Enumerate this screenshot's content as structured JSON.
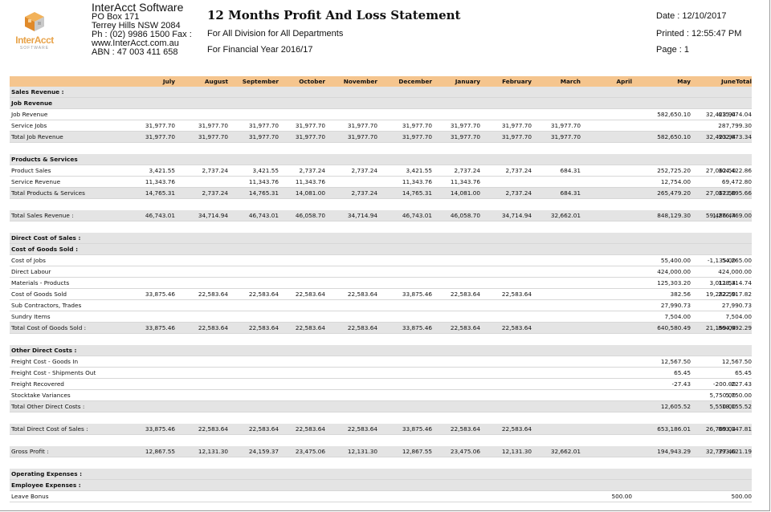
{
  "company": {
    "logo_text": "InterAcct",
    "logo_sub": "SOFTWARE",
    "name": "InterAcct Software",
    "address1": "PO Box 171",
    "address2": "Terrey Hills NSW 2084",
    "phone": "Ph : (02) 9986 1500 Fax :",
    "web": "www.InterAcct.com.au",
    "abn": "ABN : 47 003 411 658"
  },
  "report": {
    "title": "12 Months Profit And Loss Statement",
    "subtitle1": "For All Division for All Departments",
    "subtitle2": "For Financial Year 2016/17",
    "date": "Date : 12/10/2017",
    "printed": "Printed : 12:55:47 PM",
    "page": "Page : 1"
  },
  "columns": [
    "July",
    "August",
    "September",
    "October",
    "November",
    "December",
    "January",
    "February",
    "March",
    "April",
    "May",
    "June",
    "Total"
  ],
  "rows": [
    {
      "label": "Sales Revenue :",
      "style": "heading",
      "shade": true,
      "values": []
    },
    {
      "label": "Job Revenue",
      "style": "heading",
      "shade": true,
      "values": []
    },
    {
      "label": "Job Revenue",
      "style": "line",
      "values": [
        "",
        "",
        "",
        "",
        "",
        "",
        "",
        "",
        "",
        "",
        "582,650.10",
        "32,423.94",
        "615,074.04"
      ]
    },
    {
      "label": "Service Jobs",
      "style": "line",
      "values": [
        "31,977.70",
        "31,977.70",
        "31,977.70",
        "31,977.70",
        "31,977.70",
        "31,977.70",
        "31,977.70",
        "31,977.70",
        "31,977.70",
        "",
        "",
        "",
        "287,799.30"
      ]
    },
    {
      "label": "Total Job Revenue",
      "style": "total",
      "shade": true,
      "values": [
        "31,977.70",
        "31,977.70",
        "31,977.70",
        "31,977.70",
        "31,977.70",
        "31,977.70",
        "31,977.70",
        "31,977.70",
        "31,977.70",
        "",
        "582,650.10",
        "32,423.94",
        "902,873.34"
      ]
    },
    {
      "label": "",
      "style": "blank",
      "values": []
    },
    {
      "label": "Products & Services",
      "style": "heading",
      "shade": true,
      "values": []
    },
    {
      "label": "Product Sales",
      "style": "line",
      "values": [
        "3,421.55",
        "2,737.24",
        "3,421.55",
        "2,737.24",
        "2,737.24",
        "3,421.55",
        "2,737.24",
        "2,737.24",
        "684.31",
        "",
        "252,725.20",
        "27,062.50",
        "304,422.86"
      ]
    },
    {
      "label": "Service Revenue",
      "style": "line",
      "values": [
        "11,343.76",
        "",
        "11,343.76",
        "11,343.76",
        "",
        "11,343.76",
        "11,343.76",
        "",
        "",
        "",
        "12,754.00",
        "",
        "69,472.80"
      ]
    },
    {
      "label": "Total Products & Services",
      "style": "total",
      "shade": true,
      "values": [
        "14,765.31",
        "2,737.24",
        "14,765.31",
        "14,081.00",
        "2,737.24",
        "14,765.31",
        "14,081.00",
        "2,737.24",
        "684.31",
        "",
        "265,479.20",
        "27,062.50",
        "373,895.66"
      ]
    },
    {
      "label": "",
      "style": "blank",
      "values": []
    },
    {
      "label": "Total Sales Revenue :",
      "style": "total",
      "shade": true,
      "values": [
        "46,743.01",
        "34,714.94",
        "46,743.01",
        "46,058.70",
        "34,714.94",
        "46,743.01",
        "46,058.70",
        "34,714.94",
        "32,662.01",
        "",
        "848,129.30",
        "59,486.44",
        "1,276,769.00"
      ]
    },
    {
      "label": "",
      "style": "blank",
      "values": []
    },
    {
      "label": "Direct Cost of Sales :",
      "style": "heading",
      "shade": true,
      "values": []
    },
    {
      "label": "Cost of Goods Sold :",
      "style": "heading",
      "shade": true,
      "values": []
    },
    {
      "label": "Cost of Jobs",
      "style": "line",
      "values": [
        "",
        "",
        "",
        "",
        "",
        "",
        "",
        "",
        "",
        "",
        "55,400.00",
        "-1,135.00",
        "54,265.00"
      ]
    },
    {
      "label": "Direct Labour",
      "style": "line",
      "values": [
        "",
        "",
        "",
        "",
        "",
        "",
        "",
        "",
        "",
        "",
        "424,000.00",
        "",
        "424,000.00"
      ]
    },
    {
      "label": "Materials - Products",
      "style": "line",
      "values": [
        "",
        "",
        "",
        "",
        "",
        "",
        "",
        "",
        "",
        "",
        "125,303.20",
        "3,011.54",
        "128,314.74"
      ]
    },
    {
      "label": "Cost of Goods Sold",
      "style": "line",
      "values": [
        "33,875.46",
        "22,583.64",
        "22,583.64",
        "22,583.64",
        "22,583.64",
        "33,875.46",
        "22,583.64",
        "22,583.64",
        "",
        "",
        "382.56",
        "19,282.50",
        "222,917.82"
      ]
    },
    {
      "label": "Sub Contractors, Trades",
      "style": "line",
      "values": [
        "",
        "",
        "",
        "",
        "",
        "",
        "",
        "",
        "",
        "",
        "27,990.73",
        "",
        "27,990.73"
      ]
    },
    {
      "label": "Sundry Items",
      "style": "line",
      "values": [
        "",
        "",
        "",
        "",
        "",
        "",
        "",
        "",
        "",
        "",
        "7,504.00",
        "",
        "7,504.00"
      ]
    },
    {
      "label": "Total Cost of Goods Sold :",
      "style": "total",
      "shade": true,
      "values": [
        "33,875.46",
        "22,583.64",
        "22,583.64",
        "22,583.64",
        "22,583.64",
        "33,875.46",
        "22,583.64",
        "22,583.64",
        "",
        "",
        "640,580.49",
        "21,159.04",
        "864,992.29"
      ]
    },
    {
      "label": "",
      "style": "blank",
      "values": []
    },
    {
      "label": "Other Direct Costs :",
      "style": "heading",
      "shade": true,
      "values": []
    },
    {
      "label": "Freight Cost - Goods In",
      "style": "line",
      "values": [
        "",
        "",
        "",
        "",
        "",
        "",
        "",
        "",
        "",
        "",
        "12,567.50",
        "",
        "12,567.50"
      ]
    },
    {
      "label": "Freight Cost - Shipments Out",
      "style": "line",
      "values": [
        "",
        "",
        "",
        "",
        "",
        "",
        "",
        "",
        "",
        "",
        "65.45",
        "",
        "65.45"
      ]
    },
    {
      "label": "Freight Recovered",
      "style": "line",
      "values": [
        "",
        "",
        "",
        "",
        "",
        "",
        "",
        "",
        "",
        "",
        "-27.43",
        "-200.00",
        "-227.43"
      ]
    },
    {
      "label": "Stocktake Variances",
      "style": "line",
      "values": [
        "",
        "",
        "",
        "",
        "",
        "",
        "",
        "",
        "",
        "",
        "",
        "5,750.00",
        "5,750.00"
      ]
    },
    {
      "label": "Total Other Direct Costs :",
      "style": "total",
      "shade": true,
      "values": [
        "",
        "",
        "",
        "",
        "",
        "",
        "",
        "",
        "",
        "",
        "12,605.52",
        "5,550.00",
        "18,155.52"
      ]
    },
    {
      "label": "",
      "style": "blank",
      "values": []
    },
    {
      "label": "Total Direct Cost of Sales :",
      "style": "total",
      "shade": true,
      "values": [
        "33,875.46",
        "22,583.64",
        "22,583.64",
        "22,583.64",
        "22,583.64",
        "33,875.46",
        "22,583.64",
        "22,583.64",
        "",
        "",
        "653,186.01",
        "26,709.04",
        "883,147.81"
      ]
    },
    {
      "label": "",
      "style": "blank",
      "values": []
    },
    {
      "label": "Gross Profit :",
      "style": "total",
      "shade": true,
      "values": [
        "12,867.55",
        "12,131.30",
        "24,159.37",
        "23,475.06",
        "12,131.30",
        "12,867.55",
        "23,475.06",
        "12,131.30",
        "32,662.01",
        "",
        "194,943.29",
        "32,777.40",
        "393,621.19"
      ]
    },
    {
      "label": "",
      "style": "blank",
      "values": []
    },
    {
      "label": "Operating Expenses :",
      "style": "heading",
      "shade": true,
      "values": []
    },
    {
      "label": "Employee Expenses :",
      "style": "heading",
      "shade": true,
      "values": []
    },
    {
      "label": "Leave Bonus",
      "style": "line",
      "values": [
        "",
        "",
        "",
        "",
        "",
        "",
        "",
        "",
        "",
        "500.00",
        "",
        "",
        "500.00"
      ]
    }
  ]
}
